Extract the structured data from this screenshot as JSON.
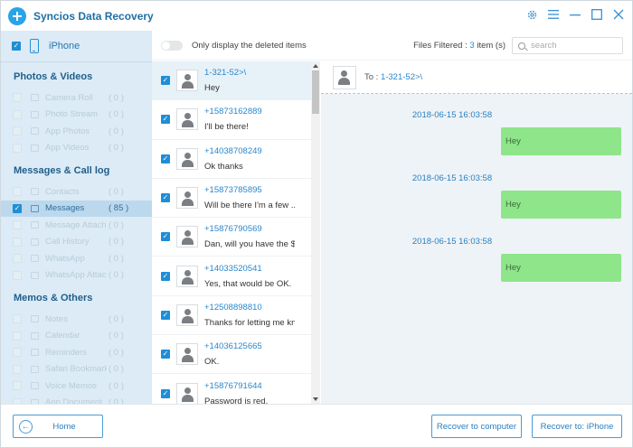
{
  "app": {
    "title": "Syncios Data Recovery"
  },
  "window_controls": [
    {
      "name": "settings-icon"
    },
    {
      "name": "menu-icon"
    },
    {
      "name": "minimize-icon"
    },
    {
      "name": "maximize-icon"
    },
    {
      "name": "close-icon"
    }
  ],
  "device": {
    "name": "iPhone",
    "checked": true
  },
  "sidebar": {
    "groups": [
      {
        "title": "Photos & Videos",
        "items": [
          {
            "label": "Camera Roll",
            "count": "( 0 )"
          },
          {
            "label": "Photo Stream",
            "count": "( 0 )"
          },
          {
            "label": "App Photos",
            "count": "( 0 )"
          },
          {
            "label": "App Videos",
            "count": "( 0 )"
          }
        ]
      },
      {
        "title": "Messages & Call log",
        "items": [
          {
            "label": "Contacts",
            "count": "( 0 )"
          },
          {
            "label": "Messages",
            "count": "( 85 )",
            "active": true
          },
          {
            "label": "Message Attach...",
            "count": "( 0 )"
          },
          {
            "label": "Call History",
            "count": "( 0 )"
          },
          {
            "label": "WhatsApp",
            "count": "( 0 )"
          },
          {
            "label": "WhatsApp Attach...",
            "count": "( 0 )"
          }
        ]
      },
      {
        "title": "Memos & Others",
        "items": [
          {
            "label": "Notes",
            "count": "( 0 )"
          },
          {
            "label": "Calendar",
            "count": "( 0 )"
          },
          {
            "label": "Reminders",
            "count": "( 0 )"
          },
          {
            "label": "Safari Bookmark",
            "count": "( 0 )"
          },
          {
            "label": "Voice Memos",
            "count": "( 0 )"
          },
          {
            "label": "App Document",
            "count": "( 0 )"
          }
        ]
      }
    ]
  },
  "toolbar": {
    "toggle_label": "Only display the deleted items",
    "files_filtered_prefix": "Files Filtered : ",
    "files_filtered_count": "3",
    "files_filtered_suffix": " item (s)",
    "search_placeholder": "search"
  },
  "conversations": [
    {
      "number": "1-321-52>\\",
      "message": "Hey",
      "selected": true
    },
    {
      "number": "+15873162889",
      "message": "I'll be there!"
    },
    {
      "number": "+14038708249",
      "message": "Ok thanks"
    },
    {
      "number": "+15873785895",
      "message": "Will be there I'm a few ..."
    },
    {
      "number": "+15876790569",
      "message": "Dan, will you have the $..."
    },
    {
      "number": "+14033520541",
      "message": "Yes, that would be OK."
    },
    {
      "number": "+12508898810",
      "message": "Thanks for letting me kn..."
    },
    {
      "number": "+14036125665",
      "message": "OK."
    },
    {
      "number": "+15876791644",
      "message": "Password is red."
    }
  ],
  "chat": {
    "to_label": "To : ",
    "to_number": "1-321-52>\\",
    "messages": [
      {
        "time": "2018-06-15 16:03:58",
        "text": "Hey"
      },
      {
        "time": "2018-06-15 16:03:58",
        "text": "Hey"
      },
      {
        "time": "2018-06-15 16:03:58",
        "text": "Hey"
      }
    ]
  },
  "footer": {
    "home_label": "Home",
    "recover_computer_label": "Recover to computer",
    "recover_iphone_label": "Recover to: iPhone"
  },
  "colors": {
    "accent": "#2a8ad0",
    "sidebar_bg": "#dcebf5",
    "bubble": "#8ee58a",
    "chat_bg": "#eef3f7"
  }
}
